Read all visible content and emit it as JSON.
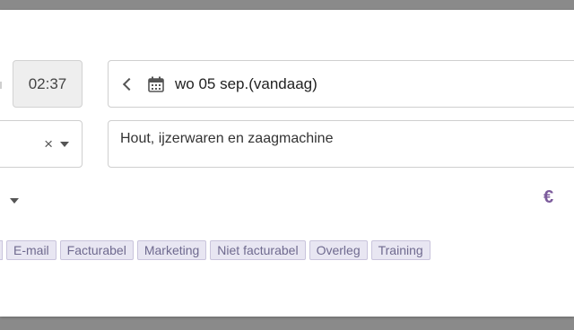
{
  "time": {
    "value": "02:37"
  },
  "date": {
    "text": "wo 05 sep.(vandaag)"
  },
  "left_select": {
    "clear_symbol": "×"
  },
  "description": {
    "text": "Hout, ijzerwaren en zaagmachine"
  },
  "currency": {
    "symbol": "€"
  },
  "tags": [
    "E-mail",
    "Facturabel",
    "Marketing",
    "Niet facturabel",
    "Overleg",
    "Training"
  ],
  "colors": {
    "accent": "#7c5b9c",
    "tag_bg": "#e8e6f2",
    "tag_text": "#6f6a8f"
  }
}
